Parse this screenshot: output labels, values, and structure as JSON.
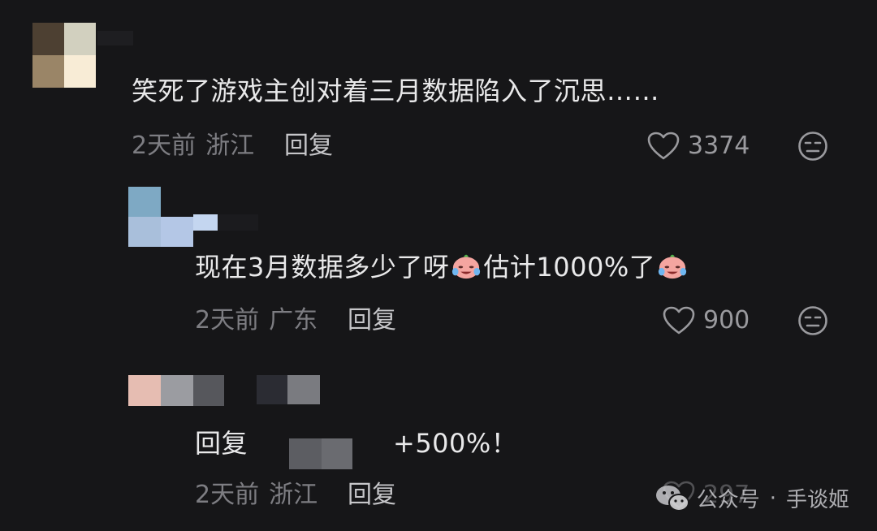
{
  "comments": [
    {
      "text": "笑死了游戏主创对着三月数据陷入了沉思……",
      "time": "2天前",
      "location": "浙江",
      "reply_label": "回复",
      "likes": "3374"
    },
    {
      "text_a": "现在3月数据多少了呀",
      "text_b": "估计1000%了",
      "emoji": "crying-laughing-face-icon",
      "time": "2天前",
      "location": "广东",
      "reply_label": "回复",
      "likes": "900"
    },
    {
      "reply_prefix": "回复",
      "text": "+500%！",
      "time": "2天前",
      "location": "浙江",
      "reply_label": "回复",
      "likes": "297"
    }
  ],
  "watermark": {
    "icon": "wechat-icon",
    "source": "公众号",
    "separator": "·",
    "account": "手谈姬"
  },
  "colors": {
    "background": "#161618",
    "text": "#e9e9ea",
    "meta": "#7d7d82"
  }
}
